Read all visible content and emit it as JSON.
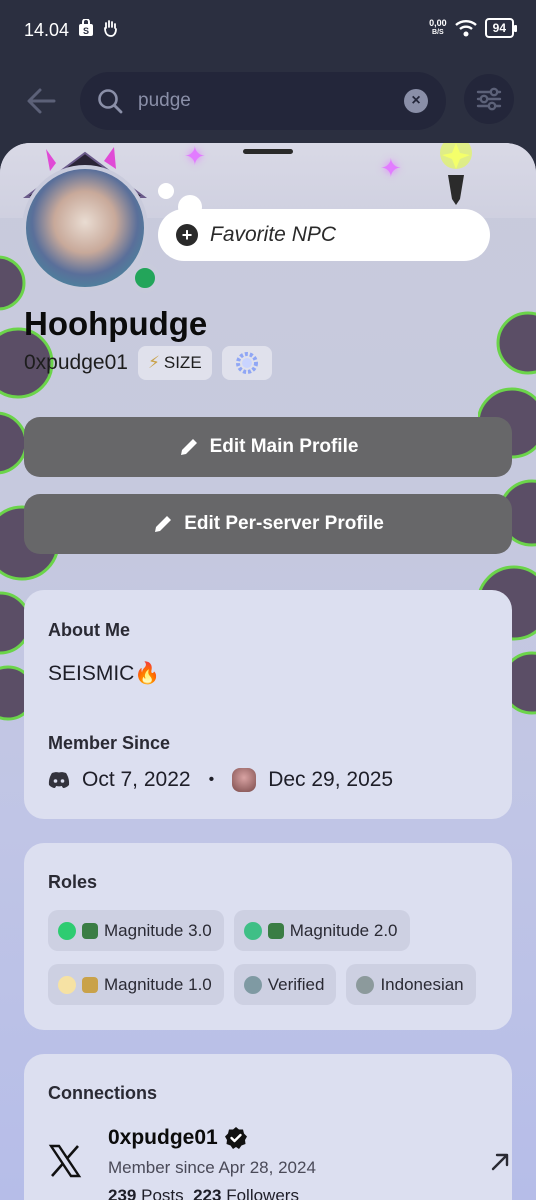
{
  "status_bar": {
    "time": "14.04",
    "net_speed_value": "0,00",
    "net_speed_unit": "B/S",
    "battery": "94"
  },
  "search": {
    "query": "pudge"
  },
  "profile": {
    "status_text": "Favorite NPC",
    "display_name": "Hoohpudge",
    "username": "0xpudge01",
    "tag_text": "SIZE",
    "online": true
  },
  "buttons": {
    "edit_main": "Edit Main Profile",
    "edit_server": "Edit Per-server Profile"
  },
  "about": {
    "title": "About Me",
    "text": "SEISMIC🔥",
    "member_since_title": "Member Since",
    "discord_since": "Oct 7, 2022",
    "server_since": "Dec 29, 2025",
    "separator": "•"
  },
  "roles": {
    "title": "Roles",
    "items": [
      {
        "label": "Magnitude 3.0",
        "color": "#2ecc71",
        "emoji_color": "#3a7d44"
      },
      {
        "label": "Magnitude 2.0",
        "color": "#3fbf86",
        "emoji_color": "#3a7d44"
      },
      {
        "label": "Magnitude 1.0",
        "color": "#f6e2a4",
        "emoji_color": "#c9a24a"
      },
      {
        "label": "Verified",
        "color": "#7f9aa3",
        "emoji_color": ""
      },
      {
        "label": "Indonesian",
        "color": "#8c9a9c",
        "emoji_color": ""
      }
    ]
  },
  "connections": {
    "title": "Connections",
    "account": {
      "name": "0xpudge01",
      "since": "Member since Apr 28, 2024",
      "posts_count": "239",
      "posts_label": "Posts",
      "followers_count": "223",
      "followers_label": "Followers"
    }
  },
  "colors": {
    "accent_dark": "#2b2f40",
    "button": "#676769",
    "card": "#dcdff0",
    "online": "#23a55a"
  }
}
